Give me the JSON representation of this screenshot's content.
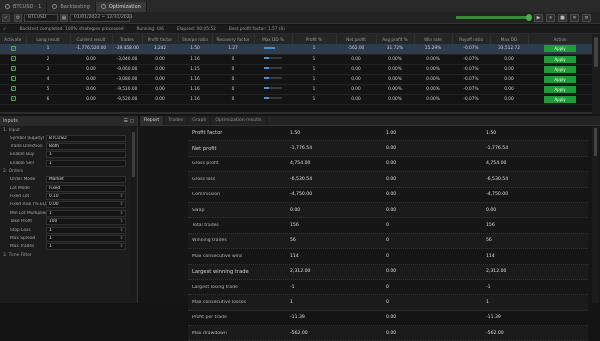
{
  "tabs": [
    {
      "label": "BTCUSD · 1",
      "icon": "chart-icon"
    },
    {
      "label": "Backtesting",
      "icon": "history-icon"
    },
    {
      "label": "Optimization",
      "icon": "gear-icon"
    }
  ],
  "toolbar": {
    "symbol": "BTCUSD",
    "range": "01/01/2023 ~ 12/31/2023",
    "progress": 0.98,
    "controls": [
      "▶",
      "⏸",
      "■",
      "✕",
      "≡"
    ]
  },
  "status": {
    "text": "Backtest completed. 100% strategies processed",
    "run": "Running: 0/6",
    "elapsed": "Elapsed: 00:05:52",
    "best": "Best profit factor: 1.57 (6)"
  },
  "grid": {
    "columns": [
      "Activate",
      "Long result",
      "Current result",
      "Trades",
      "Profit factor",
      "Sharpe ratio",
      "Recovery factor",
      "Max DD %",
      "Profit %",
      "Net profit",
      "Avg profit %",
      "Win rate",
      "Payoff ratio",
      "Max DD",
      "Action"
    ],
    "rows": [
      {
        "sel": true,
        "v": [
          "1",
          "-1,776,520.00",
          "-39,458.00",
          "3,242",
          "1.50",
          "1.27",
          "1",
          "-562.00",
          "31.72%",
          "15.29%",
          "-0.07%",
          "33,512.72",
          "-0.07",
          "-533.71"
        ],
        "bar": 0.6
      },
      {
        "sel": false,
        "v": [
          "2",
          "0.00",
          "-3,040.00",
          "0.00",
          "1.16",
          "0",
          "1",
          "0.00",
          "0.00%",
          "0.00%",
          "-0.07%",
          "0.00",
          "0.00",
          "0.00"
        ],
        "bar": 0.3
      },
      {
        "sel": false,
        "v": [
          "3",
          "0.00",
          "-9,060.00",
          "0.00",
          "1.15",
          "0",
          "1",
          "0.00",
          "0.00%",
          "0.00%",
          "-0.07%",
          "0.00",
          "0.00",
          "0.00"
        ],
        "bar": 0.3
      },
      {
        "sel": false,
        "v": [
          "4",
          "0.00",
          "-3,080.00",
          "0.00",
          "1.16",
          "0",
          "1",
          "0.00",
          "0.00%",
          "0.00%",
          "-0.07%",
          "0.00",
          "0.00",
          "0.00"
        ],
        "bar": 0.3
      },
      {
        "sel": false,
        "v": [
          "5",
          "0.00",
          "-9,510.00",
          "0.00",
          "1.16",
          "0",
          "1",
          "0.00",
          "0.00%",
          "0.00%",
          "-0.07%",
          "0.00",
          "0.00",
          "0.00"
        ],
        "bar": 0.3
      },
      {
        "sel": false,
        "v": [
          "6",
          "0.00",
          "-9,520.00",
          "0.00",
          "1.16",
          "0",
          "1",
          "0.00",
          "0.00%",
          "0.00%",
          "-0.07%",
          "0.00",
          "0.00",
          "0.00"
        ],
        "bar": 0.3
      }
    ],
    "apply_label": "Apply"
  },
  "left": {
    "title": "Inputs",
    "sections": [
      {
        "title": "1. Input",
        "rows": [
          {
            "label": "Symbol (Equity)",
            "value": "BTCUSD",
            "unit": ""
          },
          {
            "label": "Trade Direction",
            "value": "Both",
            "unit": ""
          },
          {
            "label": "Enable Buy",
            "value": "1",
            "unit": ""
          },
          {
            "label": "Enable Sell",
            "value": "1",
            "unit": ""
          }
        ]
      },
      {
        "title": "2. Orders",
        "rows": [
          {
            "label": "Order Mode",
            "value": "Market",
            "unit": ""
          },
          {
            "label": "Lot Mode",
            "value": "Fixed",
            "unit": ""
          },
          {
            "label": "Fixed Lot",
            "value": "0.10",
            "unit": "$"
          },
          {
            "label": "Fixed Risk (% EQUITY)",
            "value": "0.00",
            "unit": "$"
          },
          {
            "label": "Min Lot Multiplier",
            "value": "1",
            "unit": "$"
          },
          {
            "label": "Take Profit",
            "value": "100",
            "unit": "$"
          },
          {
            "label": "Stop Loss",
            "value": "1",
            "unit": "$"
          },
          {
            "label": "Max Spread",
            "value": "1",
            "unit": "$"
          },
          {
            "label": "Max Trades",
            "value": "1",
            "unit": "$"
          }
        ]
      },
      {
        "title": "3. Time Filter",
        "rows": []
      }
    ]
  },
  "right": {
    "tabs": [
      "Report",
      "Trades",
      "Graph",
      "Optimization results"
    ],
    "rows": [
      {
        "label": "Profit factor",
        "c1": "1.50",
        "c2": "1.00",
        "c3": "1.50",
        "big": true
      },
      {
        "label": "Net profit",
        "c1": "-1,776.54",
        "c2": "0.00",
        "c3": "-1,776.54",
        "big": true
      },
      {
        "label": "Gross profit",
        "c1": "4,754.00",
        "c2": "0.00",
        "c3": "4,754.00",
        "big": false
      },
      {
        "label": "Gross loss",
        "c1": "-6,530.54",
        "c2": "0.00",
        "c3": "-6,530.54",
        "big": false
      },
      {
        "label": "Commission",
        "c1": "-4,750.00",
        "c2": "0.00",
        "c3": "-4,750.00",
        "big": false
      },
      {
        "label": "Swap",
        "c1": "0.00",
        "c2": "0.00",
        "c3": "0.00",
        "big": false
      },
      {
        "label": "Total trades",
        "c1": "156",
        "c2": "0",
        "c3": "156",
        "big": false
      },
      {
        "label": "Winning trades",
        "c1": "56",
        "c2": "0",
        "c3": "56",
        "big": false
      },
      {
        "label": "Max consecutive wins",
        "c1": "114",
        "c2": "0",
        "c3": "114",
        "big": false
      },
      {
        "label": "Largest winning trade",
        "c1": "2,312.00",
        "c2": "0.00",
        "c3": "2,312.00",
        "big": true
      },
      {
        "label": "Largest losing trade",
        "c1": "-1",
        "c2": "0",
        "c3": "-1",
        "big": false
      },
      {
        "label": "Max consecutive losses",
        "c1": "1",
        "c2": "0",
        "c3": "1",
        "big": false
      },
      {
        "label": "Profit per trade",
        "c1": "-11.39",
        "c2": "0.00",
        "c3": "-11.39",
        "big": false
      },
      {
        "label": "Max drawdown",
        "c1": "-562.00",
        "c2": "0.00",
        "c3": "-562.00",
        "big": false
      }
    ]
  }
}
